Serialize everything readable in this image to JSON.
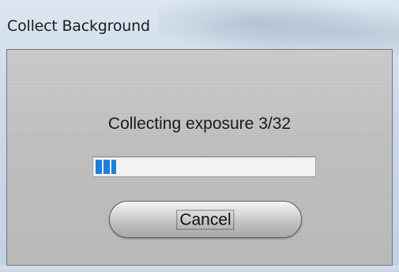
{
  "window": {
    "title": "Collect Background"
  },
  "dialog": {
    "status_text": "Collecting exposure 3/32",
    "progress": {
      "current": 3,
      "total": 32,
      "fraction": 0.09375,
      "accent_color": "#1e7fdc"
    },
    "cancel_label": "Cancel"
  }
}
